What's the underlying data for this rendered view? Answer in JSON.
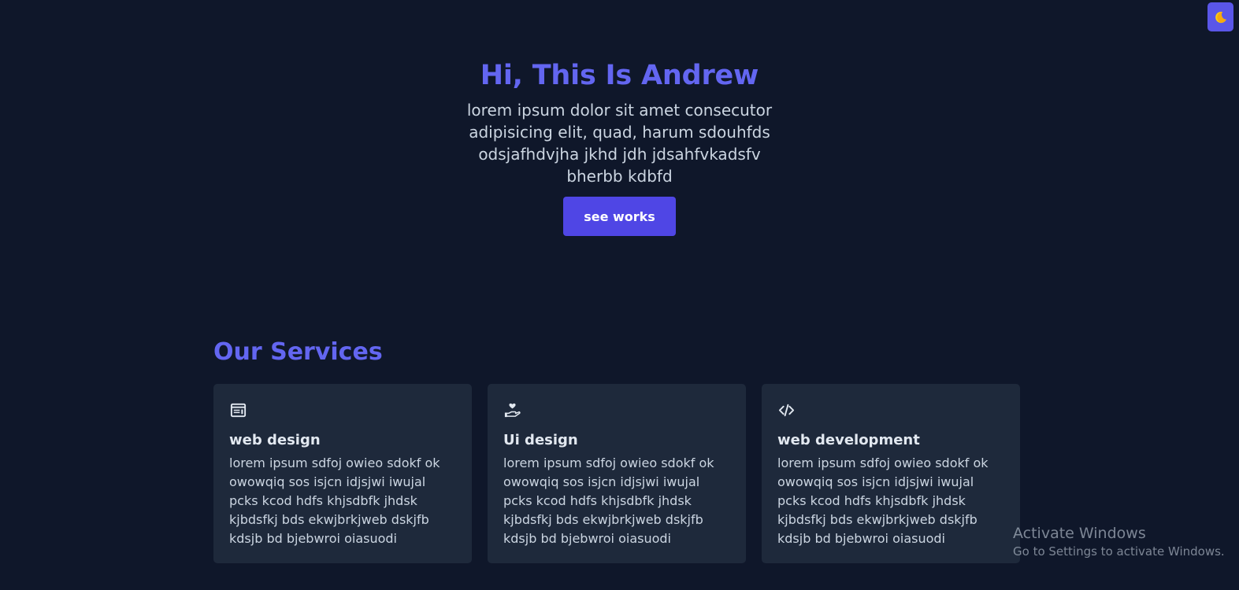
{
  "theme_toggle": {
    "icon": "moon-icon",
    "background": "#5a56e8"
  },
  "hero": {
    "title": "Hi, This Is Andrew",
    "description": "lorem ipsum dolor sit amet consecutor adipisicing elit, quad, harum sdouhfds odsjafhdvjha jkhd jdh jdsahfvkadsfv bherbb kdbfd",
    "button_label": "see works",
    "accent": "#6366f1",
    "button_color": "#4f46e5"
  },
  "services": {
    "title": "Our Services",
    "cards": [
      {
        "icon": "browser-window-icon",
        "title": "web design",
        "description": "lorem ipsum sdfoj owieo sdokf ok owowqiq sos isjcn idjsjwi iwujal pcks kcod hdfs khjsdbfk jhdsk kjbdsfkj bds ekwjbrkjweb dskjfb kdsjb bd bjebwroi oiasuodi"
      },
      {
        "icon": "heart-hand-icon",
        "title": "Ui design",
        "description": "lorem ipsum sdfoj owieo sdokf ok owowqiq sos isjcn idjsjwi iwujal pcks kcod hdfs khjsdbfk jhdsk kjbdsfkj bds ekwjbrkjweb dskjfb kdsjb bd bjebwroi oiasuodi"
      },
      {
        "icon": "code-icon",
        "title": "web development",
        "description": "lorem ipsum sdfoj owieo sdokf ok owowqiq sos isjcn idjsjwi iwujal pcks kcod hdfs khjsdbfk jhdsk kjbdsfkj bds ekwjbrkjweb dskjfb kdsjb bd bjebwroi oiasuodi"
      }
    ]
  },
  "system_watermark": {
    "title": "Activate Windows",
    "subtitle": "Go to Settings to activate Windows."
  },
  "colors": {
    "background": "#0f172a",
    "card_background": "#1e293b",
    "text": "#cbd5e1",
    "heading_text": "#e2e8f0"
  }
}
